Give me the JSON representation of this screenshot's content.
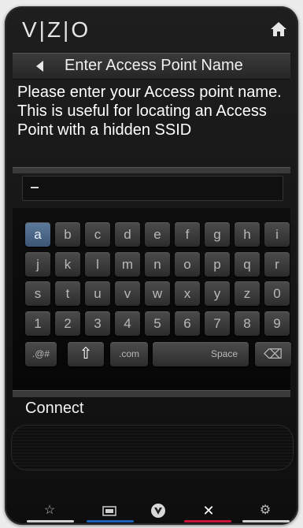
{
  "header": {
    "logo": "VIZIO",
    "home_icon": "home-icon"
  },
  "titlebar": {
    "title": "Enter Access Point Name"
  },
  "description": "Please enter your Access point name. This is useful for locating an Access Point with a hidden SSID",
  "input": {
    "value": ""
  },
  "keyboard": {
    "row1": [
      "a",
      "b",
      "c",
      "d",
      "e",
      "f",
      "g",
      "h",
      "i"
    ],
    "row2": [
      "j",
      "k",
      "l",
      "m",
      "n",
      "o",
      "p",
      "q",
      "r"
    ],
    "row3": [
      "s",
      "t",
      "u",
      "v",
      "w",
      "x",
      "y",
      "z",
      "0"
    ],
    "row4": [
      "1",
      "2",
      "3",
      "4",
      "5",
      "6",
      "7",
      "8",
      "9"
    ],
    "row5": {
      "symbols": ".@#",
      "shift": "⇧",
      "com": ".com",
      "space": "Space",
      "backspace": "⌫"
    },
    "selected": "a"
  },
  "connect_label": "Connect",
  "footer": {
    "colors": [
      "#d0d0d0",
      "#1e5fb8",
      "#d0d0d0",
      "#c8143c",
      "#d0d0d0"
    ]
  }
}
